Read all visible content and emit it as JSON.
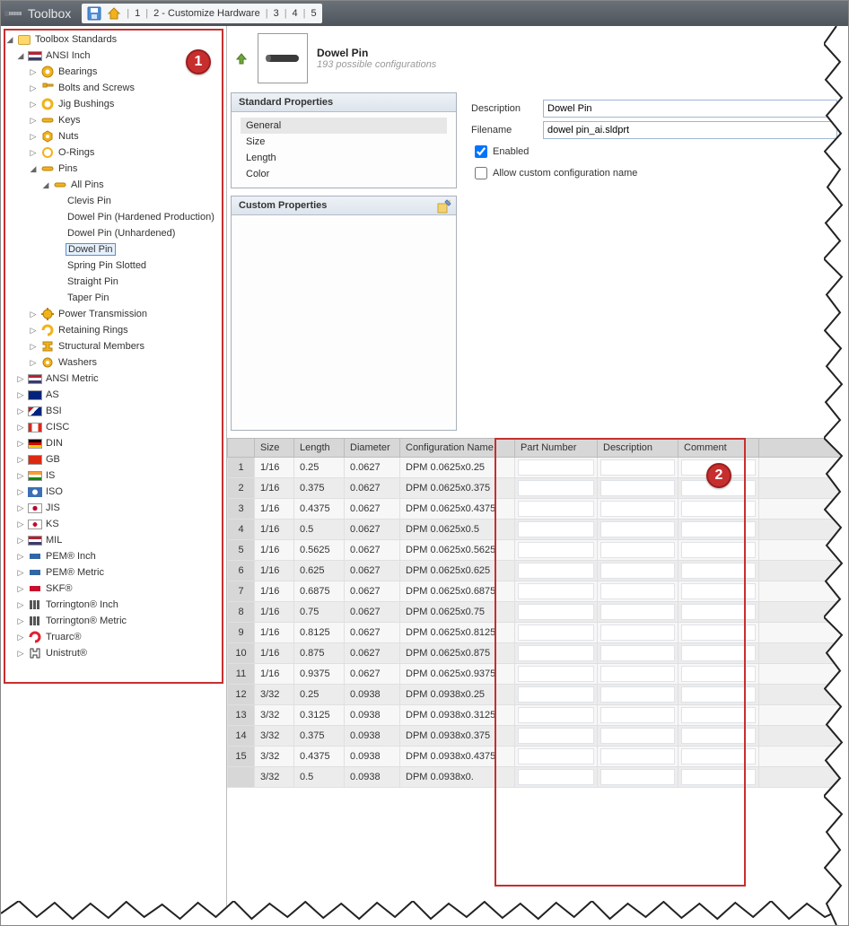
{
  "titlebar": {
    "title": "Toolbox"
  },
  "breadcrumbs": {
    "b1": "1",
    "b2": "2 - Customize Hardware",
    "b3": "3",
    "b4": "4",
    "b5": "5"
  },
  "tree": {
    "root": "Toolbox Standards",
    "ansi_inch": "ANSI Inch",
    "cats": {
      "bearings": "Bearings",
      "bolts": "Bolts and Screws",
      "jig": "Jig Bushings",
      "keys": "Keys",
      "nuts": "Nuts",
      "orings": "O-Rings",
      "pins": "Pins",
      "allpins": "All Pins",
      "clevis": "Clevis Pin",
      "dowel_hard": "Dowel Pin (Hardened Production)",
      "dowel_un": "Dowel Pin (Unhardened)",
      "dowel": "Dowel Pin",
      "spring": "Spring Pin Slotted",
      "straight": "Straight Pin",
      "taper": "Taper Pin",
      "power": "Power Transmission",
      "retaining": "Retaining Rings",
      "structural": "Structural Members",
      "washers": "Washers"
    },
    "stds": {
      "ansi_metric": "ANSI Metric",
      "as": "AS",
      "bsi": "BSI",
      "cisc": "CISC",
      "din": "DIN",
      "gb": "GB",
      "is": "IS",
      "iso": "ISO",
      "jis": "JIS",
      "ks": "KS",
      "mil": "MIL",
      "pem_in": "PEM® Inch",
      "pem_m": "PEM® Metric",
      "skf": "SKF®",
      "torr_in": "Torrington® Inch",
      "torr_m": "Torrington® Metric",
      "truarc": "Truarc®",
      "unistrut": "Unistrut®"
    }
  },
  "part": {
    "name": "Dowel Pin",
    "sub": "193 possible configurations"
  },
  "panels": {
    "std_props": "Standard Properties",
    "general": "General",
    "size": "Size",
    "length": "Length",
    "color": "Color",
    "custom_props": "Custom Properties",
    "description_label": "Description",
    "description_value": "Dowel Pin",
    "filename_label": "Filename",
    "filename_value": "dowel pin_ai.sldprt",
    "enabled": "Enabled",
    "allow_custom": "Allow custom configuration name"
  },
  "grid": {
    "headers": {
      "rownum": "",
      "size": "Size",
      "length": "Length",
      "diameter": "Diameter",
      "config": "Configuration Name",
      "partnum": "Part Number",
      "desc": "Description",
      "comment": "Comment"
    },
    "rows": [
      {
        "n": "1",
        "size": "1/16",
        "length": "0.25",
        "dia": "0.0627",
        "cfg": "DPM 0.0625x0.25"
      },
      {
        "n": "2",
        "size": "1/16",
        "length": "0.375",
        "dia": "0.0627",
        "cfg": "DPM 0.0625x0.375"
      },
      {
        "n": "3",
        "size": "1/16",
        "length": "0.4375",
        "dia": "0.0627",
        "cfg": "DPM 0.0625x0.4375"
      },
      {
        "n": "4",
        "size": "1/16",
        "length": "0.5",
        "dia": "0.0627",
        "cfg": "DPM 0.0625x0.5"
      },
      {
        "n": "5",
        "size": "1/16",
        "length": "0.5625",
        "dia": "0.0627",
        "cfg": "DPM 0.0625x0.5625"
      },
      {
        "n": "6",
        "size": "1/16",
        "length": "0.625",
        "dia": "0.0627",
        "cfg": "DPM 0.0625x0.625"
      },
      {
        "n": "7",
        "size": "1/16",
        "length": "0.6875",
        "dia": "0.0627",
        "cfg": "DPM 0.0625x0.6875"
      },
      {
        "n": "8",
        "size": "1/16",
        "length": "0.75",
        "dia": "0.0627",
        "cfg": "DPM 0.0625x0.75"
      },
      {
        "n": "9",
        "size": "1/16",
        "length": "0.8125",
        "dia": "0.0627",
        "cfg": "DPM 0.0625x0.8125"
      },
      {
        "n": "10",
        "size": "1/16",
        "length": "0.875",
        "dia": "0.0627",
        "cfg": "DPM 0.0625x0.875"
      },
      {
        "n": "11",
        "size": "1/16",
        "length": "0.9375",
        "dia": "0.0627",
        "cfg": "DPM 0.0625x0.9375"
      },
      {
        "n": "12",
        "size": "3/32",
        "length": "0.25",
        "dia": "0.0938",
        "cfg": "DPM 0.0938x0.25"
      },
      {
        "n": "13",
        "size": "3/32",
        "length": "0.3125",
        "dia": "0.0938",
        "cfg": "DPM 0.0938x0.3125"
      },
      {
        "n": "14",
        "size": "3/32",
        "length": "0.375",
        "dia": "0.0938",
        "cfg": "DPM 0.0938x0.375"
      },
      {
        "n": "15",
        "size": "3/32",
        "length": "0.4375",
        "dia": "0.0938",
        "cfg": "DPM 0.0938x0.4375"
      },
      {
        "n": "",
        "size": "3/32",
        "length": "0.5",
        "dia": "0.0938",
        "cfg": "DPM 0.0938x0."
      }
    ]
  },
  "callouts": {
    "c1": "1",
    "c2": "2"
  }
}
